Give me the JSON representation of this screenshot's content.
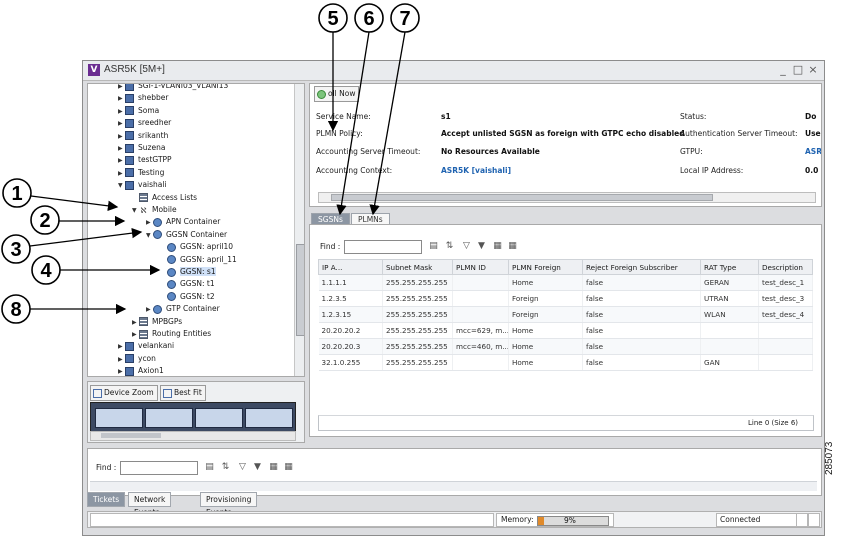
{
  "window": {
    "title": "ASR5K [5M+]",
    "logo_letter": "V",
    "controls": [
      "_",
      "□",
      "×"
    ]
  },
  "tree": {
    "items": [
      {
        "label": "SGI-1-VLANI03_VLANI13",
        "icon": "host-icon",
        "expanded": false
      },
      {
        "label": "shebber",
        "icon": "host-icon",
        "expanded": false
      },
      {
        "label": "Soma",
        "icon": "host-icon",
        "expanded": false
      },
      {
        "label": "sreedher",
        "icon": "host-icon",
        "expanded": false
      },
      {
        "label": "srikanth",
        "icon": "host-icon",
        "expanded": false
      },
      {
        "label": "Suzena",
        "icon": "host-icon",
        "expanded": false
      },
      {
        "label": "testGTPP",
        "icon": "host-icon",
        "expanded": false
      },
      {
        "label": "Testing",
        "icon": "host-icon",
        "expanded": false
      },
      {
        "label": "vaishali",
        "icon": "host-icon",
        "expanded": true
      },
      {
        "label": "Access Lists",
        "icon": "list-icon"
      },
      {
        "label": "Mobile",
        "icon": "mobile-icon",
        "expanded": true
      },
      {
        "label": "APN Container",
        "icon": "apn-container-icon",
        "expanded": false
      },
      {
        "label": "GGSN Container",
        "icon": "ggsn-container-icon",
        "expanded": true
      },
      {
        "label": "GGSN: april10",
        "icon": "ggsn-icon"
      },
      {
        "label": "GGSN: april_11",
        "icon": "ggsn-icon"
      },
      {
        "label": "GGSN: s1",
        "icon": "ggsn-icon",
        "selected": true
      },
      {
        "label": "GGSN: t1",
        "icon": "ggsn-icon"
      },
      {
        "label": "GGSN: t2",
        "icon": "ggsn-icon"
      },
      {
        "label": "GTP Container",
        "icon": "gtp-container-icon",
        "expanded": false
      },
      {
        "label": "MPBGPs",
        "icon": "list-icon",
        "expanded": false
      },
      {
        "label": "Routing Entities",
        "icon": "list-icon",
        "expanded": false
      },
      {
        "label": "velankani",
        "icon": "host-icon",
        "expanded": false
      },
      {
        "label": "ycon",
        "icon": "host-icon",
        "expanded": false
      },
      {
        "label": "Axion1",
        "icon": "host-icon",
        "expanded": false
      }
    ]
  },
  "zoom_panel": {
    "device_zoom_label": "Device Zoom",
    "best_fit_label": "Best Fit"
  },
  "detail": {
    "refresh_label": "oll Now",
    "left_fields": [
      {
        "label": "Service Name:",
        "value": "s1",
        "link": false
      },
      {
        "label": "PLMN Policy:",
        "value": "Accept unlisted SGSN as foreign with GTPC echo disabled",
        "link": false
      },
      {
        "label": "Accounting Server Timeout:",
        "value": "No Resources Available",
        "link": false
      },
      {
        "label": "Accounting Context:",
        "value": "ASR5K [vaishali]",
        "link": true
      }
    ],
    "right_fields": [
      {
        "label": "Status:",
        "value": "Do",
        "link": false
      },
      {
        "label": "Authentication Server Timeout:",
        "value": "Use",
        "link": false
      },
      {
        "label": "GTPU:",
        "value": "ASR",
        "link": true
      },
      {
        "label": "Local IP Address:",
        "value": "0.0",
        "link": false
      }
    ]
  },
  "tabs": [
    {
      "label": "SGSNs",
      "active": true
    },
    {
      "label": "PLMNs",
      "active": false
    }
  ],
  "table": {
    "find_label": "Find :",
    "columns": [
      "IP A...",
      "Subnet Mask",
      "PLMN ID",
      "PLMN Foreign",
      "Reject Foreign Subscriber",
      "RAT Type",
      "Description"
    ],
    "rows": [
      [
        "1.1.1.1",
        "255.255.255.255",
        "",
        "Home",
        "false",
        "GERAN",
        "test_desc_1"
      ],
      [
        "1.2.3.5",
        "255.255.255.255",
        "",
        "Foreign",
        "false",
        "UTRAN",
        "test_desc_3"
      ],
      [
        "1.2.3.15",
        "255.255.255.255",
        "",
        "Foreign",
        "false",
        "WLAN",
        "test_desc_4"
      ],
      [
        "20.20.20.2",
        "255.255.255.255",
        "mcc=629, m...",
        "Home",
        "false",
        "",
        ""
      ],
      [
        "20.20.20.3",
        "255.255.255.255",
        "mcc=460, m...",
        "Home",
        "false",
        "",
        ""
      ],
      [
        "32.1.0.255",
        "255.255.255.255",
        "",
        "Home",
        "false",
        "GAN",
        ""
      ]
    ],
    "status": "Line 0 (Size 6)"
  },
  "bottom": {
    "find_label": "Find :",
    "tabs": [
      {
        "label": "Tickets",
        "active": true
      },
      {
        "label": "Network Events",
        "active": false
      },
      {
        "label": "Provisioning Events",
        "active": false
      }
    ]
  },
  "statusbar": {
    "memory_label": "Memory:",
    "memory_value": "9%",
    "memory_fraction": 0.09,
    "connection": "Connected"
  },
  "callouts": {
    "numbers": [
      "1",
      "2",
      "3",
      "4",
      "5",
      "6",
      "7",
      "8"
    ]
  },
  "figure_number": "285073",
  "colors": {
    "accent_purple": "#6a2c91",
    "link_blue": "#1e62b0",
    "tab_active": "#8c96a3",
    "memory_orange": "#e08a2b"
  }
}
